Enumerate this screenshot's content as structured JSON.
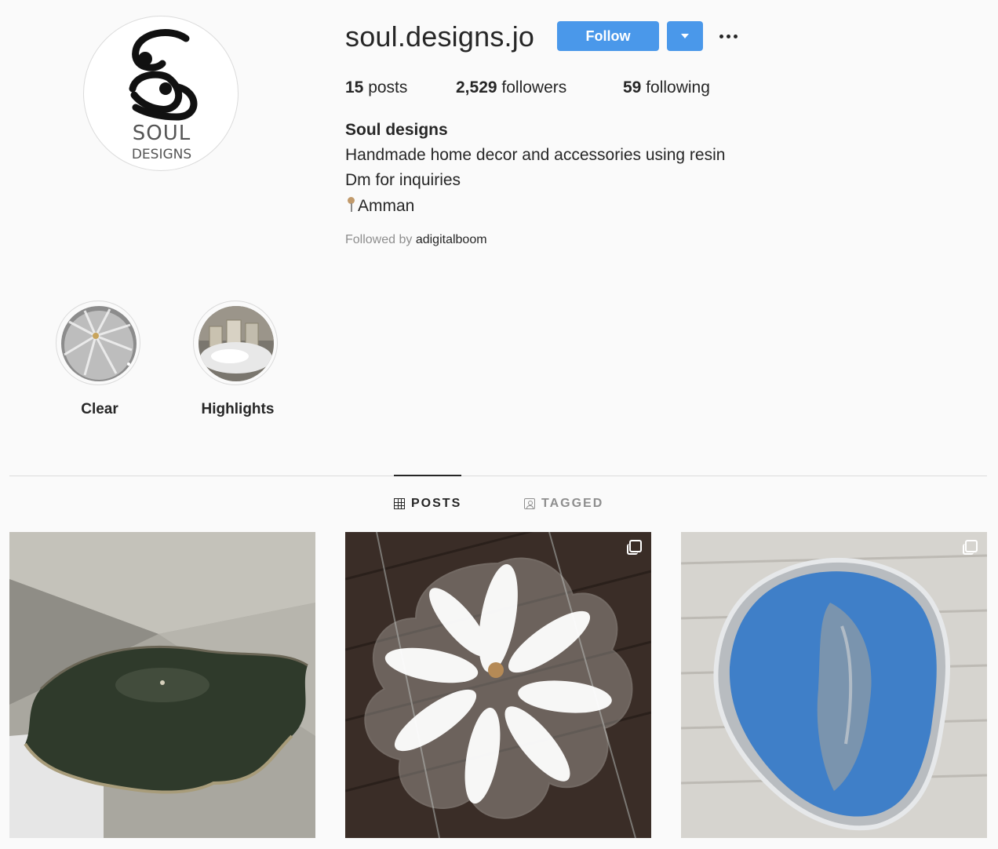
{
  "profile": {
    "username": "soul.designs.jo",
    "avatar_text_top": "SOUL",
    "avatar_text_bottom": "DESIGNS",
    "follow_label": "Follow",
    "accent_color": "#4a98ea",
    "stats": {
      "posts_count": "15",
      "posts_label": "posts",
      "followers_count": "2,529",
      "followers_label": "followers",
      "following_count": "59",
      "following_label": "following"
    },
    "full_name": "Soul designs",
    "bio_lines": [
      "Handmade home decor and accessories using resin",
      "Dm for inquiries",
      "Amman"
    ],
    "followed_by_prefix": "Followed by",
    "followed_by_user": "adigitalboom"
  },
  "highlights": [
    {
      "label": "Clear"
    },
    {
      "label": "Highlights"
    }
  ],
  "tabs": [
    {
      "label": "POSTS",
      "icon": "grid-icon",
      "active": true
    },
    {
      "label": "TAGGED",
      "icon": "tag-icon",
      "active": false
    }
  ],
  "posts": [
    {
      "description": "dark green resin tray",
      "multiple": false
    },
    {
      "description": "clear resin flower tray with white petals",
      "multiple": true
    },
    {
      "description": "blue resin bowl with silver edge",
      "multiple": true
    }
  ]
}
